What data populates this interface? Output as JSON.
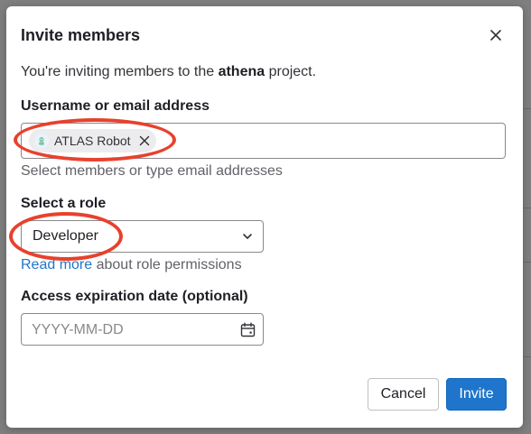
{
  "dialog": {
    "title": "Invite members",
    "close_icon": "close-icon",
    "intro_prefix": "You're inviting members to the ",
    "project_name": "athena",
    "intro_suffix": " project."
  },
  "members_field": {
    "label": "Username or email address",
    "tokens": [
      {
        "label": "ATLAS Robot",
        "avatar_icon": "robot-avatar-icon"
      }
    ],
    "help": "Select members or type email addresses"
  },
  "role_field": {
    "label": "Select a role",
    "selected": "Developer",
    "help_link": "Read more",
    "help_suffix": " about role permissions"
  },
  "expiration_field": {
    "label": "Access expiration date (optional)",
    "value": "",
    "placeholder": "YYYY-MM-DD"
  },
  "actions": {
    "cancel_label": "Cancel",
    "invite_label": "Invite"
  },
  "colors": {
    "primary": "#1f75cb",
    "annotation": "#e8412d"
  }
}
